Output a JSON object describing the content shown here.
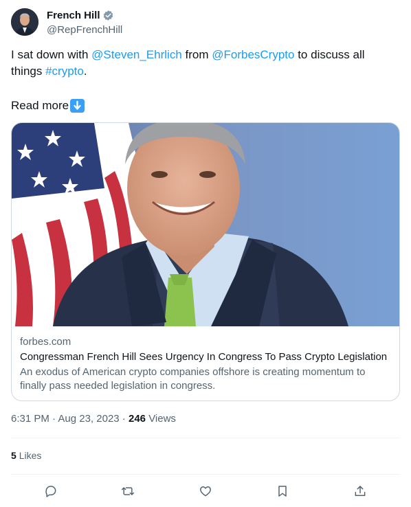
{
  "author": {
    "display_name": "French Hill",
    "handle": "@RepFrenchHill"
  },
  "tweet": {
    "text_1": "I sat down with ",
    "mention_1": "@Steven_Ehrlich",
    "text_2": " from ",
    "mention_2": "@ForbesCrypto",
    "text_3": " to discuss all things ",
    "hashtag": "#crypto",
    "text_4": ".",
    "read_more": "Read more",
    "emoji": "arrow-down-emoji"
  },
  "card": {
    "domain": "forbes.com",
    "title": "Congressman French Hill Sees Urgency In Congress To Pass Crypto Legislation",
    "description": "An exodus of American crypto companies offshore is creating momentum to finally pass needed legislation in congress."
  },
  "meta": {
    "time": "6:31 PM",
    "date": "Aug 23, 2023",
    "views_count": "246",
    "views_label": "Views"
  },
  "stats": {
    "likes_count": "5",
    "likes_label": "Likes"
  },
  "actions": [
    "reply-icon",
    "retweet-icon",
    "like-icon",
    "bookmark-icon",
    "share-icon"
  ],
  "colors": {
    "link": "#1d9bf0",
    "text": "#0f1419",
    "secondary": "#536471",
    "border": "#cfd9de"
  }
}
